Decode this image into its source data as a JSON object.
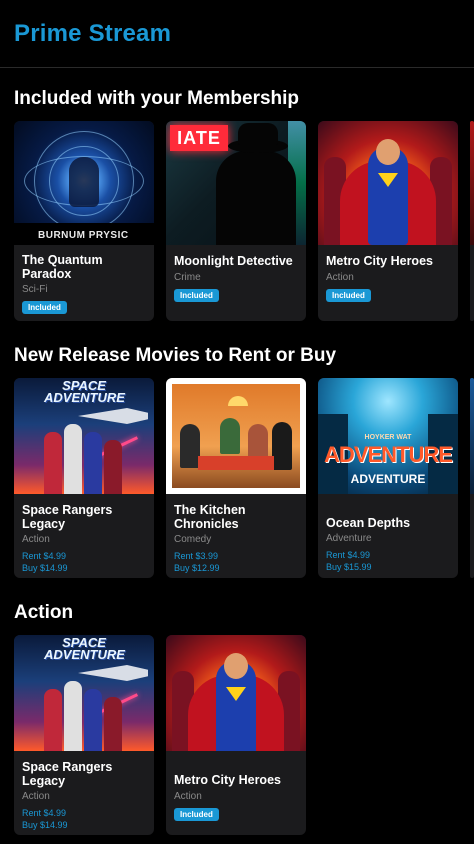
{
  "app": {
    "title": "Prime Stream"
  },
  "sections": [
    {
      "title": "Included with your Membership",
      "cards": [
        {
          "title": "The Quantum Paradox",
          "genre": "Sci-Fi",
          "badge": "Included",
          "poster_caption": "BURNUM PRYSIC",
          "poster_icon": "glowing-figure-icon"
        },
        {
          "title": "Moonlight Detective",
          "genre": "Crime",
          "badge": "Included",
          "poster_sign": "IATE",
          "poster_icon": "fedora-silhouette-icon"
        },
        {
          "title": "Metro City Heroes",
          "genre": "Action",
          "badge": "Included",
          "poster_icon": "superhero-icon"
        }
      ]
    },
    {
      "title": "New Release Movies to Rent or Buy",
      "cards": [
        {
          "title": "Space Rangers Legacy",
          "genre": "Action",
          "rent": "Rent $4.99",
          "buy": "Buy $14.99",
          "poster_logo": "SPACE ADVENTURE",
          "poster_icon": "spaceship-icon"
        },
        {
          "title": "The Kitchen Chronicles",
          "genre": "Comedy",
          "rent": "Rent $3.99",
          "buy": "Buy $12.99",
          "poster_icon": "dinner-table-icon"
        },
        {
          "title": "Ocean Depths",
          "genre": "Adventure",
          "rent": "Rent $4.99",
          "buy": "Buy $15.99",
          "poster_sub": "HOYKER WAT",
          "poster_big": "ADVENTURE",
          "poster_small": "ADVENTURE",
          "poster_icon": "underwater-icon"
        }
      ]
    },
    {
      "title": "Action",
      "cards": [
        {
          "title": "Space Rangers Legacy",
          "genre": "Action",
          "rent": "Rent $4.99",
          "buy": "Buy $14.99",
          "poster_logo": "SPACE ADVENTURE",
          "poster_icon": "spaceship-icon"
        },
        {
          "title": "Metro City Heroes",
          "genre": "Action",
          "badge": "Included",
          "poster_icon": "superhero-icon"
        }
      ]
    }
  ],
  "colors": {
    "accent": "#1a98d5",
    "background": "#000000",
    "card": "#1b1b1d",
    "muted_text": "#8a8a8a"
  }
}
